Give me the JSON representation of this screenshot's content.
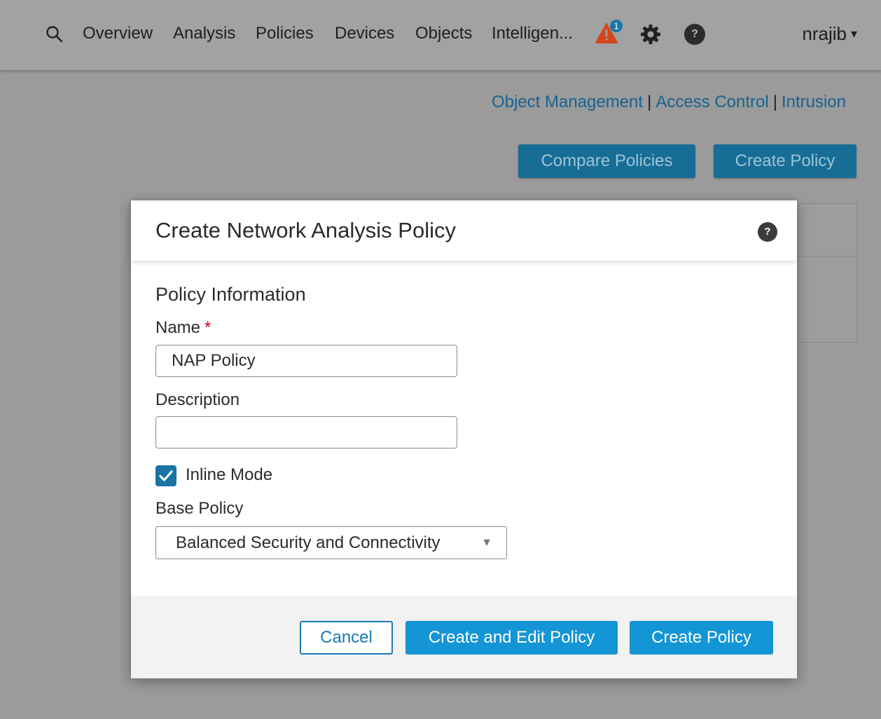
{
  "nav": {
    "items": [
      "Overview",
      "Analysis",
      "Policies",
      "Devices",
      "Objects",
      "Intelligen..."
    ],
    "alert_count": "1",
    "alert_color": "#d4461c",
    "help_glyph": "?",
    "user": "nrajib",
    "user_caret": "▾"
  },
  "sublinks": {
    "object_management": "Object Management",
    "access_control": "Access Control",
    "intrusion": "Intrusion",
    "separator": "|"
  },
  "page_buttons": {
    "compare": "Compare Policies",
    "create": "Create Policy"
  },
  "modal": {
    "title": "Create Network Analysis Policy",
    "help_glyph": "?",
    "section_title": "Policy Information",
    "name_label": "Name",
    "required_mark": "*",
    "name_value": "NAP Policy",
    "description_label": "Description",
    "description_value": "",
    "inline_mode_label": "Inline Mode",
    "inline_mode_checked": true,
    "base_policy_label": "Base Policy",
    "base_policy_value": "Balanced Security and Connectivity",
    "buttons": {
      "cancel": "Cancel",
      "create_and_edit": "Create and Edit Policy",
      "create": "Create Policy"
    }
  },
  "colors": {
    "accent": "#1495d6",
    "checkbox": "#1a74a4",
    "link": "#17628e",
    "required": "#d0021b"
  },
  "icons": [
    "search-icon",
    "alert-icon",
    "gear-icon",
    "help-icon",
    "checkmark-icon",
    "dropdown-caret-icon"
  ]
}
